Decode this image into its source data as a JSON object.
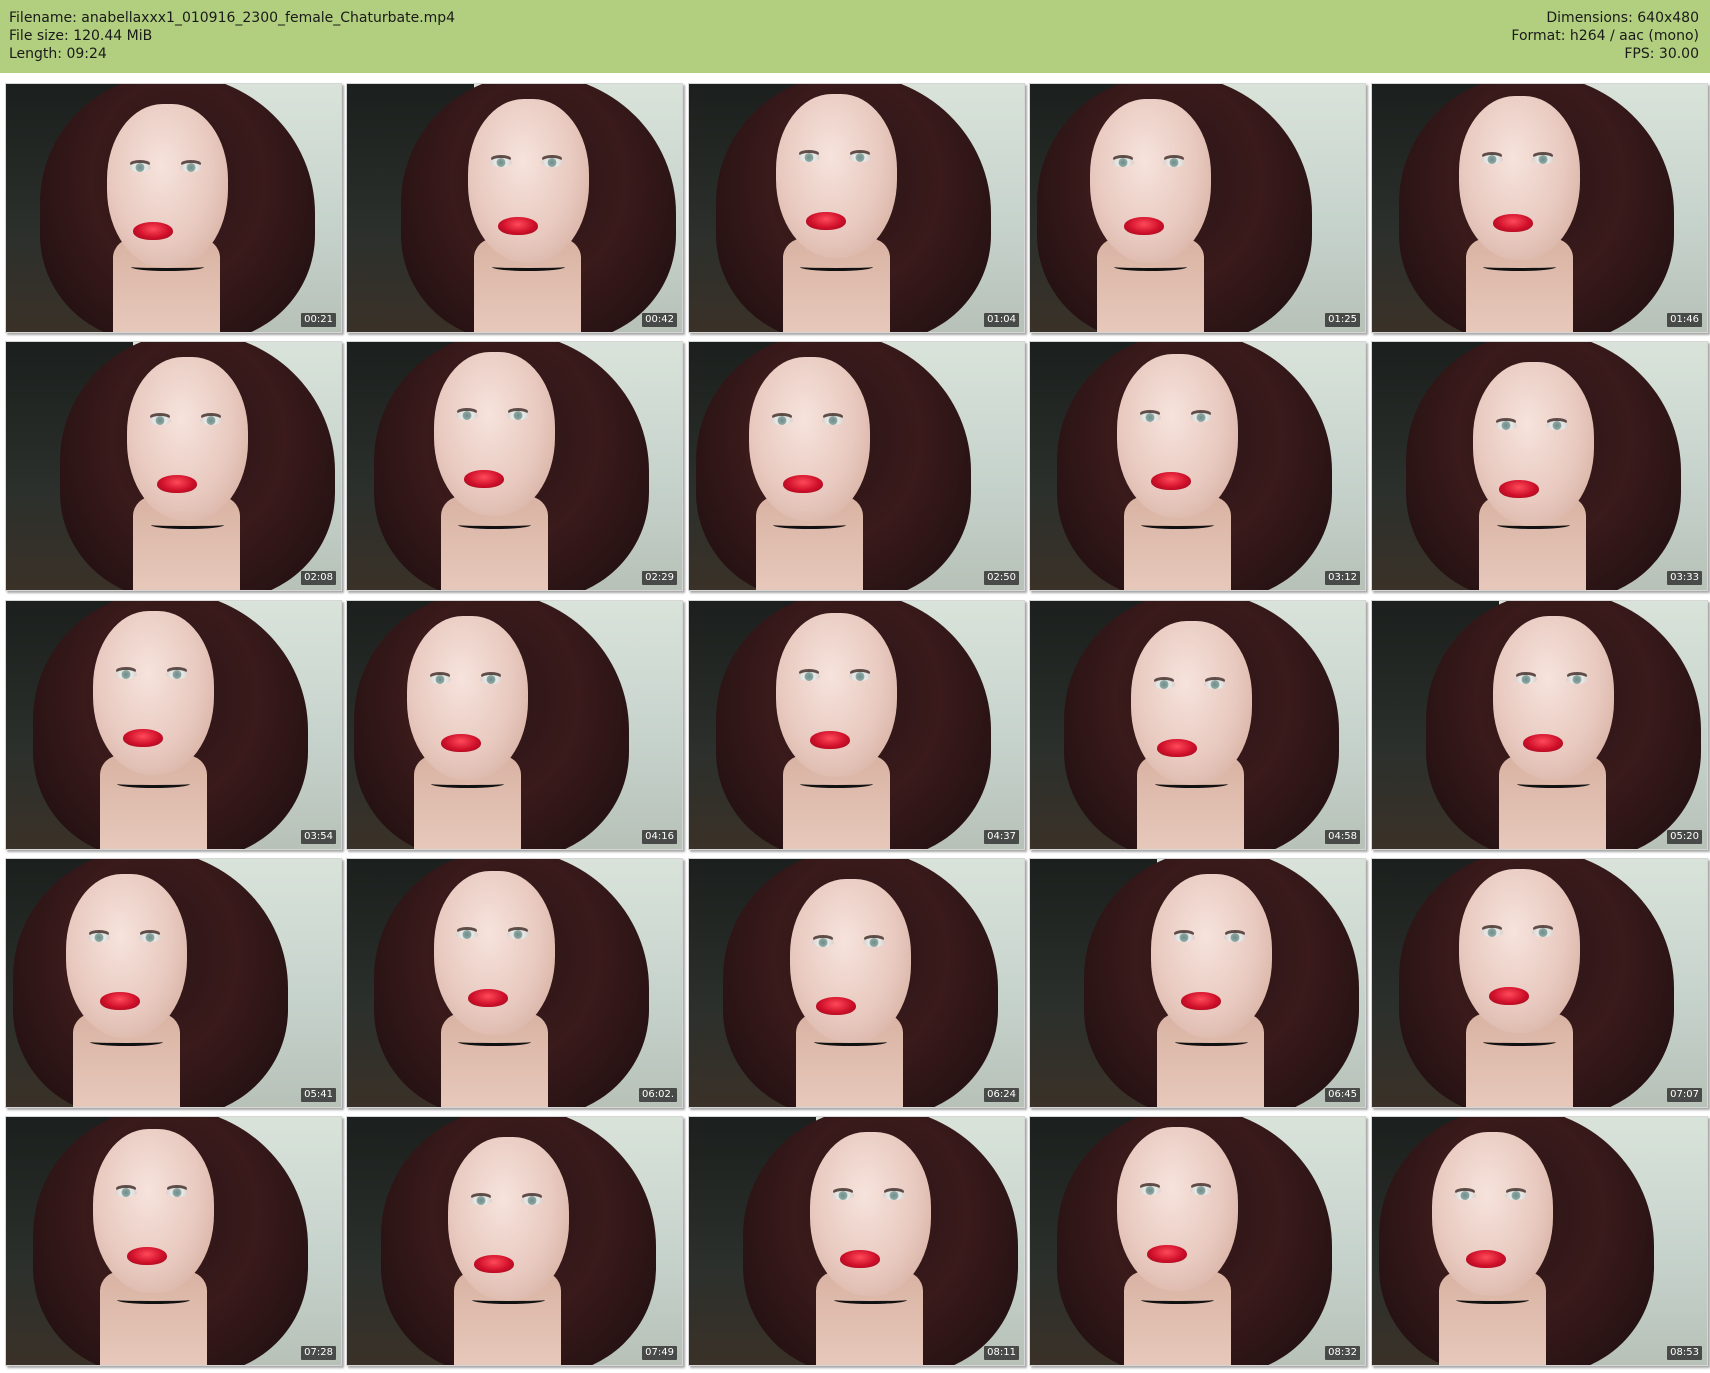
{
  "header": {
    "filename": "Filename: anabellaxxx1_010916_2300_female_Chaturbate.mp4",
    "filesize": "File size: 120.44 MiB",
    "length": "Length: 09:24",
    "dimensions": "Dimensions: 640x480",
    "format": "Format: h264 / aac (mono)",
    "fps": "FPS: 30.00",
    "background_color": "#b2cf7f"
  },
  "thumbnails": [
    {
      "timestamp": "00:21"
    },
    {
      "timestamp": "00:42"
    },
    {
      "timestamp": "01:04"
    },
    {
      "timestamp": "01:25"
    },
    {
      "timestamp": "01:46"
    },
    {
      "timestamp": "02:08"
    },
    {
      "timestamp": "02:29"
    },
    {
      "timestamp": "02:50"
    },
    {
      "timestamp": "03:12"
    },
    {
      "timestamp": "03:33"
    },
    {
      "timestamp": "03:54"
    },
    {
      "timestamp": "04:16"
    },
    {
      "timestamp": "04:37"
    },
    {
      "timestamp": "04:58"
    },
    {
      "timestamp": "05:20"
    },
    {
      "timestamp": "05:41"
    },
    {
      "timestamp": "06:02."
    },
    {
      "timestamp": "06:24"
    },
    {
      "timestamp": "06:45"
    },
    {
      "timestamp": "07:07"
    },
    {
      "timestamp": "07:28"
    },
    {
      "timestamp": "07:49"
    },
    {
      "timestamp": "08:11"
    },
    {
      "timestamp": "08:32"
    },
    {
      "timestamp": "08:53"
    }
  ]
}
